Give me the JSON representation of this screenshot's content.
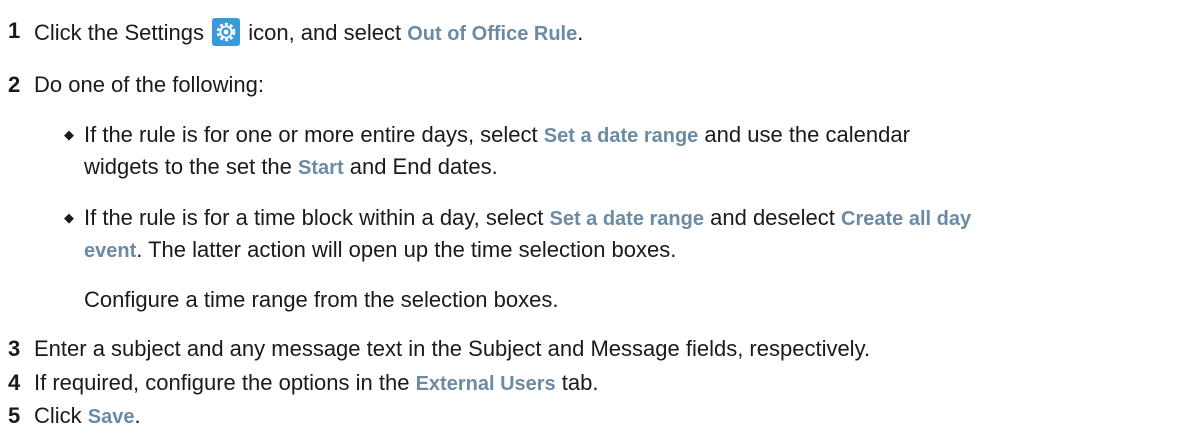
{
  "steps": [
    {
      "number": "1",
      "before": "Click the Settings",
      "middle": "icon, and select",
      "ui": "Out of Office Rule",
      "after": ".",
      "icon": "gear-icon"
    },
    {
      "number": "2",
      "text": "Do one of the following:",
      "bullets": [
        {
          "line1_a": "If the rule is for one or more entire days, select",
          "line1_ui": "Set a date range",
          "line1_b": "and use the calendar",
          "line2_a": "widgets to the set the",
          "line2_ui": "Start",
          "line2_b": "and End dates."
        },
        {
          "line1_a": "If the rule is for a time block within a day, select",
          "line1_ui1": "Set a date range",
          "line1_b": "and deselect",
          "line1_ui2": "Create all day",
          "line2_ui": "event",
          "line2_b": ". The latter action will open up the time selection boxes."
        }
      ],
      "note": "Configure a time range from the selection boxes."
    },
    {
      "number": "3",
      "text": "Enter a subject and any message text in the Subject and Message fields, respectively."
    },
    {
      "number": "4",
      "before": "If required, configure the options in the",
      "ui": "External Users",
      "after": "tab."
    },
    {
      "number": "5",
      "before": "Click",
      "ui": "Save",
      "after": "."
    }
  ],
  "colors": {
    "ui_text": "#6b8ba4",
    "body_text": "#1a1a1a",
    "icon_blue": "#3a9ad9"
  }
}
